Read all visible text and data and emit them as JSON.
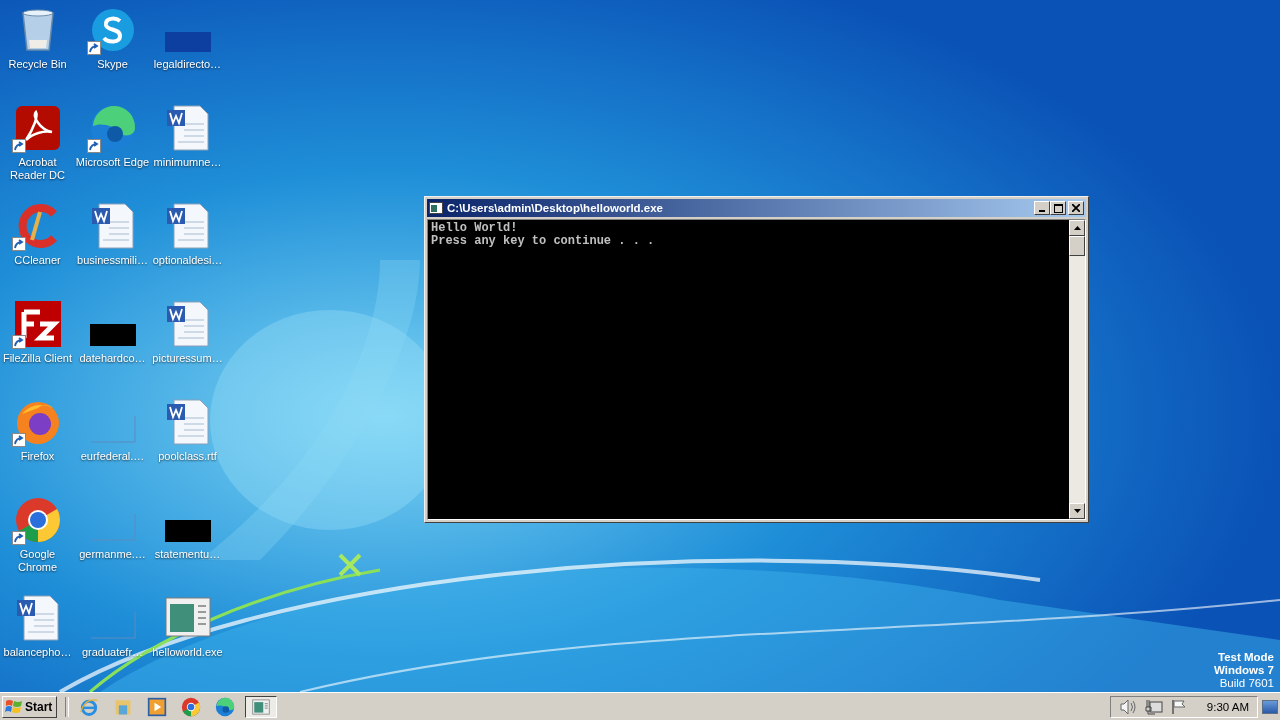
{
  "desktop": {
    "icons": [
      {
        "label": "Recycle Bin",
        "kind": "recycle",
        "shortcut": false
      },
      {
        "label": "Acrobat Reader DC",
        "kind": "pdf",
        "shortcut": true
      },
      {
        "label": "CCleaner",
        "kind": "ccleaner",
        "shortcut": true
      },
      {
        "label": "FileZilla Client",
        "kind": "filezilla",
        "shortcut": true
      },
      {
        "label": "Firefox",
        "kind": "firefox",
        "shortcut": true
      },
      {
        "label": "Google Chrome",
        "kind": "chrome",
        "shortcut": true
      },
      {
        "label": "balancepho…",
        "kind": "word",
        "shortcut": false
      },
      {
        "label": "Skype",
        "kind": "skype",
        "shortcut": true
      },
      {
        "label": "Microsoft Edge",
        "kind": "edge",
        "shortcut": true
      },
      {
        "label": "businessmili…",
        "kind": "word",
        "shortcut": false
      },
      {
        "label": "datehardco…",
        "kind": "black",
        "shortcut": false
      },
      {
        "label": "eurfederal.…",
        "kind": "blank",
        "shortcut": false
      },
      {
        "label": "germanme.…",
        "kind": "blank",
        "shortcut": false
      },
      {
        "label": "graduatefr…",
        "kind": "blank",
        "shortcut": false
      },
      {
        "label": "legaldirecto…",
        "kind": "dark",
        "shortcut": false
      },
      {
        "label": "minimumne…",
        "kind": "word",
        "shortcut": false
      },
      {
        "label": "optionaldesi…",
        "kind": "word",
        "shortcut": false
      },
      {
        "label": "picturessum…",
        "kind": "word",
        "shortcut": false
      },
      {
        "label": "poolclass.rtf",
        "kind": "word",
        "shortcut": false
      },
      {
        "label": "statementu…",
        "kind": "black",
        "shortcut": false
      },
      {
        "label": "helloworld.exe",
        "kind": "exe",
        "shortcut": false
      }
    ]
  },
  "console_window": {
    "title": "C:\\Users\\admin\\Desktop\\helloworld.exe",
    "lines": [
      "Hello World!",
      "Press any key to continue . . ."
    ]
  },
  "test_mode_notice": [
    {
      "text": "Test Mode",
      "bold": true
    },
    {
      "text": "Windows 7",
      "bold": true
    },
    {
      "text": "Build 7601",
      "bold": false
    }
  ],
  "taskbar": {
    "start": "Start",
    "quick_launch": [
      {
        "kind": "ie"
      },
      {
        "kind": "explorer"
      },
      {
        "kind": "media"
      },
      {
        "kind": "chrome"
      },
      {
        "kind": "edge"
      }
    ],
    "tasks": [
      {
        "kind": "exe",
        "selected": true
      }
    ],
    "tray": [
      {
        "kind": "speaker"
      },
      {
        "kind": "network"
      },
      {
        "kind": "flag"
      }
    ],
    "clock": "9:30 AM"
  }
}
